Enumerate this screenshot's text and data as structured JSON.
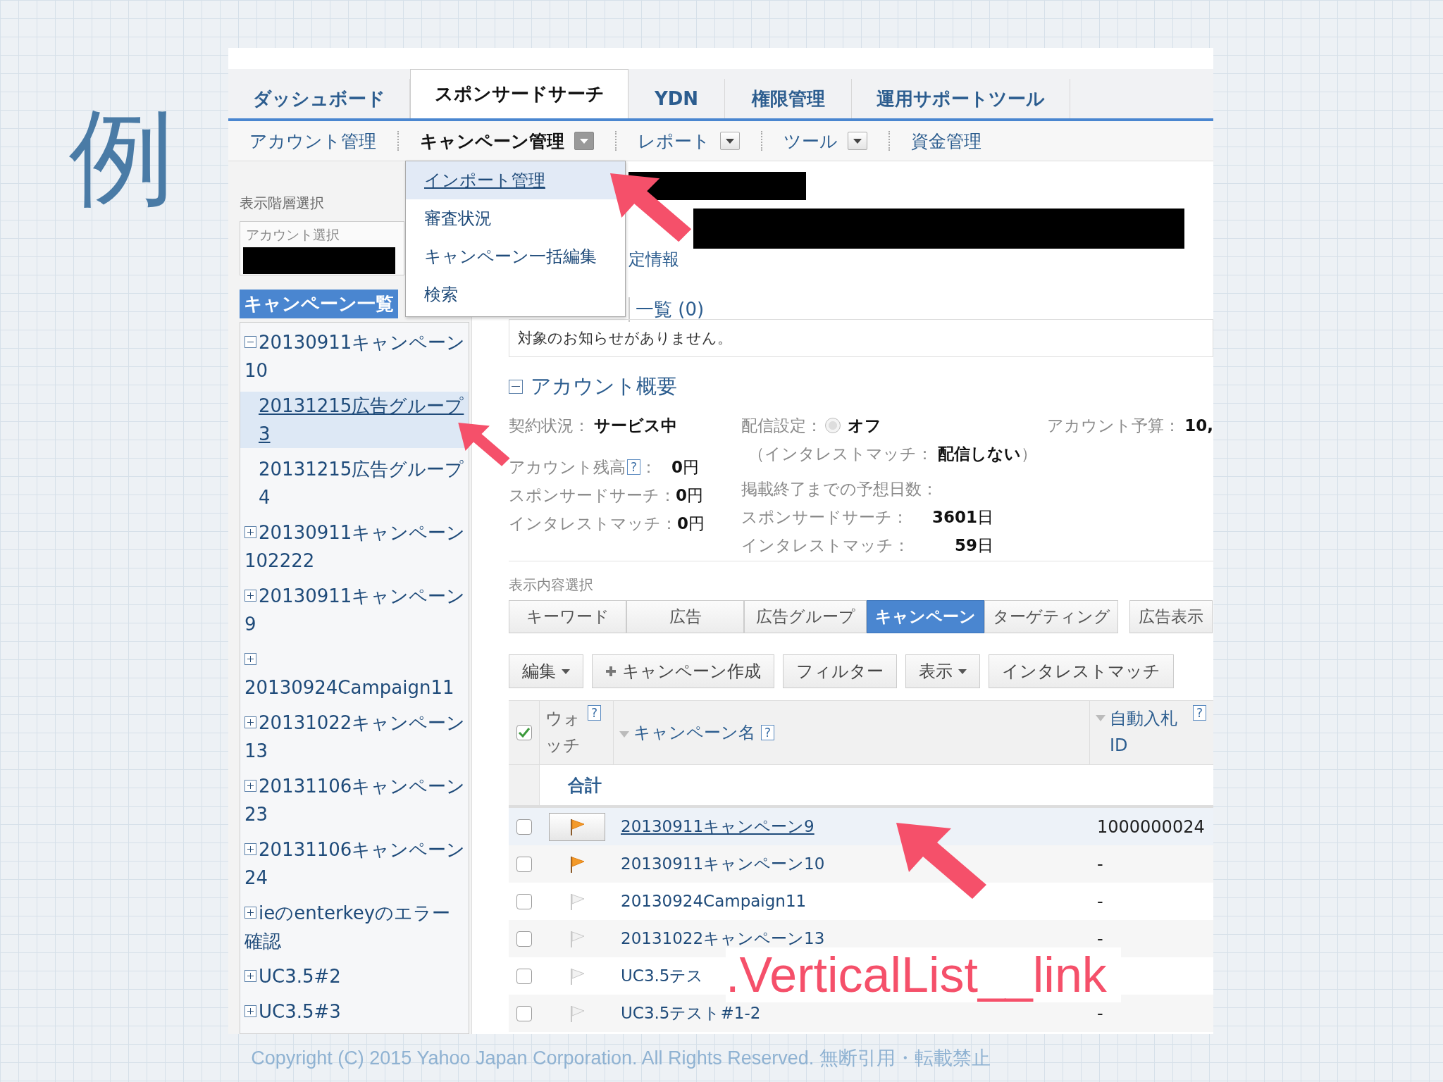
{
  "slide_title": "例",
  "top_tabs": [
    {
      "label": "ダッシュボード",
      "selected": false
    },
    {
      "label": "スポンサードサーチ",
      "selected": true
    },
    {
      "label": "YDN",
      "selected": false
    },
    {
      "label": "権限管理",
      "selected": false
    },
    {
      "label": "運用サポートツール",
      "selected": false
    }
  ],
  "sub_nav": [
    {
      "label": "アカウント管理",
      "active": false,
      "dropdown": false
    },
    {
      "label": "キャンペーン管理",
      "active": true,
      "dropdown": true
    },
    {
      "label": "レポート",
      "active": false,
      "dropdown": true
    },
    {
      "label": "ツール",
      "active": false,
      "dropdown": true
    },
    {
      "label": "資金管理",
      "active": false,
      "dropdown": false
    }
  ],
  "dropdown_menu": [
    {
      "label": "インポート管理",
      "selected": true
    },
    {
      "label": "審査状況",
      "selected": false
    },
    {
      "label": "キャンペーン一括編集",
      "selected": false
    },
    {
      "label": "検索",
      "selected": false
    }
  ],
  "sidebar": {
    "section_label": "表示階層選択",
    "account_select_label": "アカウント選択",
    "list_header": "キャンペーン一覧",
    "tree": [
      {
        "label": "20130911キャンペーン10",
        "expanded": true,
        "selected": false,
        "children": [
          {
            "label": "20131215広告グループ3",
            "selected": true
          },
          {
            "label": "20131215広告グループ4",
            "selected": false
          }
        ]
      },
      {
        "label": "20130911キャンペーン102222",
        "expanded": false,
        "selected": false
      },
      {
        "label": "20130911キャンペーン9",
        "expanded": false,
        "selected": false
      },
      {
        "label": "20130924Campaign11",
        "expanded": false,
        "selected": false
      },
      {
        "label": "20131022キャンペーン13",
        "expanded": false,
        "selected": false
      },
      {
        "label": "20131106キャンペーン23",
        "expanded": false,
        "selected": false
      },
      {
        "label": "20131106キャンペーン24",
        "expanded": false,
        "selected": false
      },
      {
        "label": "ieのenterkeyのエラー確認",
        "expanded": false,
        "selected": false
      },
      {
        "label": "UC3.5#2",
        "expanded": false,
        "selected": false
      },
      {
        "label": "UC3.5#3",
        "expanded": false,
        "selected": false
      }
    ]
  },
  "content": {
    "settings_fragment": "定情報",
    "notice_tab": "一覧 (0)",
    "notice": "対象のお知らせがありません。",
    "overview": {
      "title": "アカウント概要",
      "expanded": true,
      "contract": {
        "label": "契約状況：",
        "value": "サービス中"
      },
      "balances": [
        {
          "label": "アカウント残高",
          "help": "?",
          "colon": "：",
          "value": "**0**円"
        },
        {
          "label": "スポンサードサーチ：",
          "value": "**0**円"
        },
        {
          "label": "インタレストマッチ：",
          "value": "**0**円"
        }
      ],
      "delivery": {
        "label": "配信設定：",
        "radio_selected": false,
        "value": "オフ",
        "note": "（インタレストマッチ： **配信しない**）"
      },
      "estimate": {
        "label": "掲載終了までの予想日数：",
        "items": [
          {
            "label": "スポンサードサーチ：",
            "value": "**3601**日"
          },
          {
            "label": "インタレストマッチ：",
            "value": "**59**日"
          }
        ]
      },
      "budget": {
        "label": "アカウント予算：",
        "value": "10,"
      }
    },
    "view_label": "表示内容選択",
    "view_tabs": [
      {
        "label": "キーワード",
        "selected": false
      },
      {
        "label": "広告",
        "selected": false
      },
      {
        "label": "広告グループ",
        "selected": false
      },
      {
        "label": "キャンペーン",
        "selected": true
      },
      {
        "label": "ターゲティング",
        "selected": false
      },
      {
        "label": "広告表示",
        "selected": false
      }
    ],
    "toolbar": [
      {
        "label": "編集",
        "kind": "menu"
      },
      {
        "label": "キャンペーン作成",
        "kind": "create"
      },
      {
        "label": "フィルター",
        "kind": "plain"
      },
      {
        "label": "表示",
        "kind": "menu"
      },
      {
        "label": "インタレストマッチ",
        "kind": "plain"
      }
    ],
    "table": {
      "select_all_checked": true,
      "columns": [
        {
          "label": "ウォッチ",
          "help": "?",
          "sortable": false
        },
        {
          "label": "キャンペーン名",
          "help": "?",
          "sortable": true
        },
        {
          "label": "自動入札 ID",
          "help": "?",
          "sortable": true
        }
      ],
      "total_label": "合計",
      "rows": [
        {
          "checked": false,
          "watched": true,
          "hovered": true,
          "name": "20130911キャンペーン9",
          "auto_bid_id": "1000000024"
        },
        {
          "checked": false,
          "watched": true,
          "hovered": false,
          "name": "20130911キャンペーン10",
          "auto_bid_id": "-"
        },
        {
          "checked": false,
          "watched": false,
          "hovered": false,
          "name": "20130924Campaign11",
          "auto_bid_id": "-"
        },
        {
          "checked": false,
          "watched": false,
          "hovered": false,
          "name": "20131022キャンペーン13",
          "auto_bid_id": "-"
        },
        {
          "checked": false,
          "watched": false,
          "hovered": false,
          "name": "UC3.5テス"
        },
        {
          "checked": false,
          "watched": false,
          "hovered": false,
          "name": "UC3.5テスト#1-2",
          "auto_bid_id": "-"
        }
      ]
    }
  },
  "annotation_label": ".VerticalList__link",
  "copyright": "Copyright (C) 2015 Yahoo Japan Corporation. All Rights Reserved. 無断引用・転載禁止"
}
